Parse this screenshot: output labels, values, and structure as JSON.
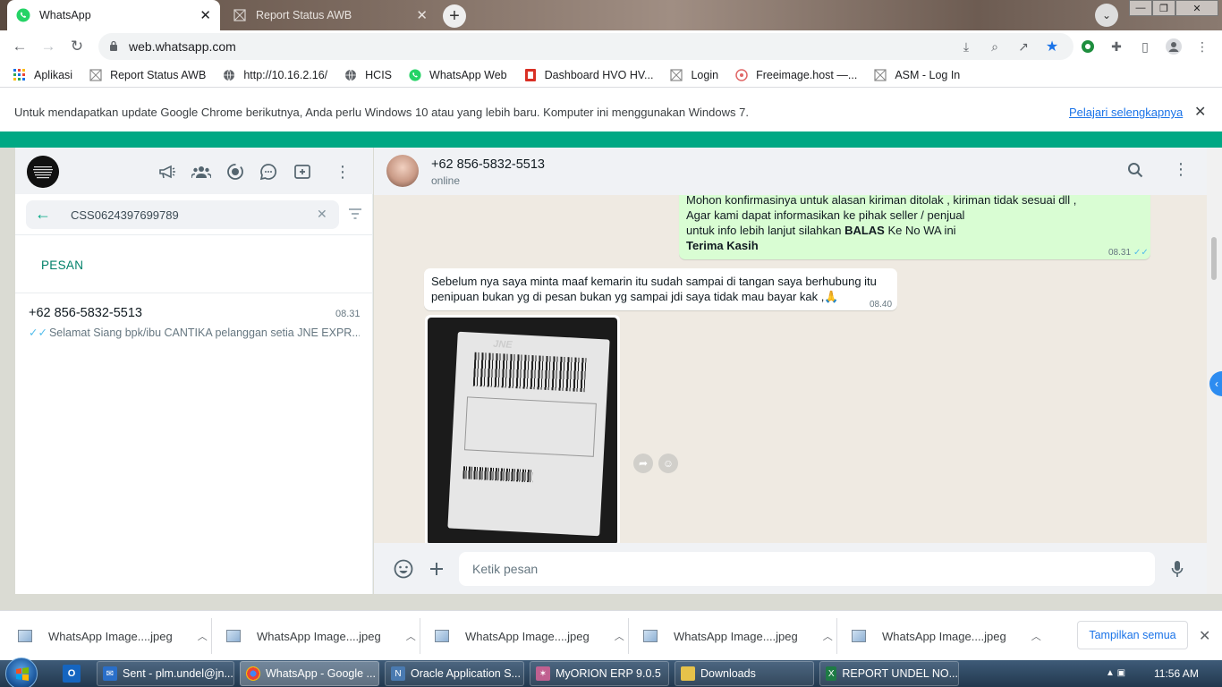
{
  "browser": {
    "tabs": [
      {
        "title": "WhatsApp",
        "icon": "whatsapp-icon",
        "active": true
      },
      {
        "title": "Report Status AWB",
        "icon": "page-icon",
        "active": false
      }
    ],
    "url": "web.whatsapp.com",
    "bookmarks": [
      {
        "label": "Aplikasi",
        "icon": "apps-grid-icon"
      },
      {
        "label": "Report Status AWB",
        "icon": "page-icon"
      },
      {
        "label": "http://10.16.2.16/",
        "icon": "globe-icon"
      },
      {
        "label": "HCIS",
        "icon": "globe-icon"
      },
      {
        "label": "WhatsApp Web",
        "icon": "whatsapp-icon"
      },
      {
        "label": "Dashboard HVO HV...",
        "icon": "dashboard-icon"
      },
      {
        "label": "Login",
        "icon": "page-icon"
      },
      {
        "label": "Freeimage.host —...",
        "icon": "freeimage-icon"
      },
      {
        "label": "ASM - Log In",
        "icon": "page-icon"
      }
    ],
    "infobar": {
      "message": "Untuk mendapatkan update Google Chrome berikutnya, Anda perlu Windows 10 atau yang lebih baru. Komputer ini menggunakan Windows 7.",
      "link": "Pelajari selengkapnya"
    }
  },
  "sidebar": {
    "search_value": "CSS0624397699789",
    "section_label": "PESAN",
    "result": {
      "name": "+62 856-5832-5513",
      "time": "08.31",
      "preview": "Selamat Siang   bpk/ibu CANTIKA pelanggan setia JNE EXPR..."
    }
  },
  "conversation": {
    "contact_name": "+62 856-5832-5513",
    "status": "online",
    "messages": [
      {
        "direction": "out",
        "lines": [
          "Mohon konfirmasinya untuk alasan kiriman ditolak , kiriman tidak sesuai dll ,",
          "Agar kami dapat informasikan ke pihak seller / penjual"
        ],
        "line3_pre": "untuk info lebih lanjut silahkan ",
        "line3_bold": "BALAS",
        "line3_post": " Ke No WA ini",
        "closing": "Terima Kasih",
        "time": "08.31"
      },
      {
        "direction": "in",
        "lines": [
          "Sebelum nya saya minta maaf kemarin itu sudah sampai di tangan saya berhubung itu",
          "penipuan bukan yg di pesan bukan yg sampai jdi saya tidak mau bayar kak ,🙏"
        ],
        "time": "08.40"
      }
    ],
    "photo_label_text": "JNE",
    "input_placeholder": "Ketik pesan"
  },
  "downloads": {
    "items": [
      "WhatsApp Image....jpeg",
      "WhatsApp Image....jpeg",
      "WhatsApp Image....jpeg",
      "WhatsApp Image....jpeg",
      "WhatsApp Image....jpeg"
    ],
    "show_all": "Tampilkan semua"
  },
  "taskbar": {
    "items": [
      {
        "label": "Sent - plm.undel@jn...",
        "icon": "outlook-icon",
        "color": "#2a6fc9"
      },
      {
        "label": "WhatsApp - Google ...",
        "icon": "chrome-icon",
        "color": "#e8a33a"
      },
      {
        "label": "Oracle Application S...",
        "icon": "oracle-icon",
        "color": "#4a7ab0"
      },
      {
        "label": "MyORION ERP 9.0.5",
        "icon": "erp-icon",
        "color": "#c06090"
      },
      {
        "label": "Downloads",
        "icon": "folder-icon",
        "color": "#e6c24a"
      },
      {
        "label": "REPORT UNDEL NO...",
        "icon": "excel-icon",
        "color": "#1e7b45"
      }
    ],
    "clock": "11:56 AM"
  },
  "colors": {
    "wa_green": "#00a884",
    "outgoing_bubble": "#d9fdd3",
    "chat_bg": "#efeae2"
  }
}
